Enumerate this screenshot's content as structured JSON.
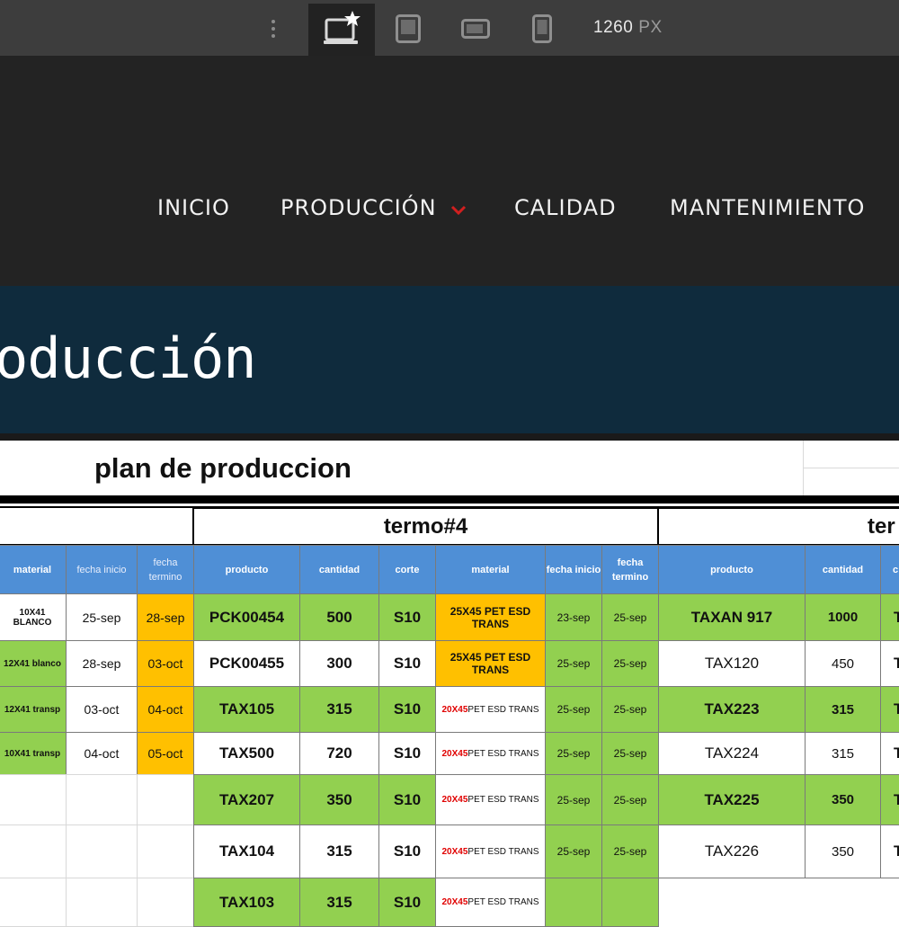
{
  "toolbar": {
    "devices": [
      "desktop-star",
      "tablet",
      "tablet-landscape",
      "mobile"
    ],
    "width_value": "1260",
    "width_unit": "PX"
  },
  "nav": {
    "items": [
      {
        "label": "INICIO"
      },
      {
        "label": "PRODUCCIÓN",
        "dropdown": true
      },
      {
        "label": "CALIDAD"
      },
      {
        "label": "MANTENIMIENTO"
      }
    ],
    "accent": "#d11f1f"
  },
  "hero": {
    "title": "oducción"
  },
  "sheet": {
    "title": "plan de produccion",
    "groups": [
      "termo#4",
      "ter"
    ],
    "headers": {
      "left": [
        "material",
        "fecha inicio",
        "fecha termino"
      ],
      "termo4": [
        "producto",
        "cantidad",
        "corte",
        "material",
        "fecha inicio",
        "fecha termino"
      ],
      "right": [
        "producto",
        "cantidad",
        "c"
      ]
    },
    "left_rows": [
      {
        "material": "10X41 BLANCO",
        "inicio": "25-sep",
        "termino": "28-sep"
      },
      {
        "material": "12X41 blanco",
        "inicio": "28-sep",
        "termino": "03-oct"
      },
      {
        "material": "12X41 transp",
        "inicio": "03-oct",
        "termino": "04-oct"
      },
      {
        "material": "10X41 transp",
        "inicio": "04-oct",
        "termino": "05-oct"
      }
    ],
    "termo4_rows": [
      {
        "producto": "PCK00454",
        "cantidad": "500",
        "corte": "S10",
        "material": "25X45 PET ESD TRANS",
        "inicio": "23-sep",
        "termino": "25-sep"
      },
      {
        "producto": "PCK00455",
        "cantidad": "300",
        "corte": "S10",
        "material": "25X45 PET ESD TRANS",
        "inicio": "25-sep",
        "termino": "25-sep"
      },
      {
        "producto": "TAX105",
        "cantidad": "315",
        "corte": "S10",
        "material_size": "20X45",
        "material_rest": " PET ESD TRANS",
        "inicio": "25-sep",
        "termino": "25-sep"
      },
      {
        "producto": "TAX500",
        "cantidad": "720",
        "corte": "S10",
        "material_size": "20X45",
        "material_rest": " PET ESD TRANS",
        "inicio": "25-sep",
        "termino": "25-sep"
      },
      {
        "producto": "TAX207",
        "cantidad": "350",
        "corte": "S10",
        "material_size": "20X45",
        "material_rest": " PET ESD TRANS",
        "inicio": "25-sep",
        "termino": "25-sep"
      },
      {
        "producto": "TAX104",
        "cantidad": "315",
        "corte": "S10",
        "material_size": "20X45",
        "material_rest": " PET ESD TRANS",
        "inicio": "25-sep",
        "termino": "25-sep"
      },
      {
        "producto": "TAX103",
        "cantidad": "315",
        "corte": "S10",
        "material_size": "20X45",
        "material_rest": " PET ESD TRANS",
        "inicio": "",
        "termino": ""
      }
    ],
    "right_rows": [
      {
        "producto": "TAXAN 917",
        "cantidad": "1000",
        "c": "T"
      },
      {
        "producto": "TAX120",
        "cantidad": "450",
        "c": "T"
      },
      {
        "producto": "TAX223",
        "cantidad": "315",
        "c": "T"
      },
      {
        "producto": "TAX224",
        "cantidad": "315",
        "c": "T"
      },
      {
        "producto": "TAX225",
        "cantidad": "350",
        "c": "T"
      },
      {
        "producto": "TAX226",
        "cantidad": "350",
        "c": "T"
      }
    ],
    "colors": {
      "header_blue": "#4f8fd6",
      "green": "#92d050",
      "orange": "#ffc000",
      "red_text": "#e00000"
    }
  }
}
